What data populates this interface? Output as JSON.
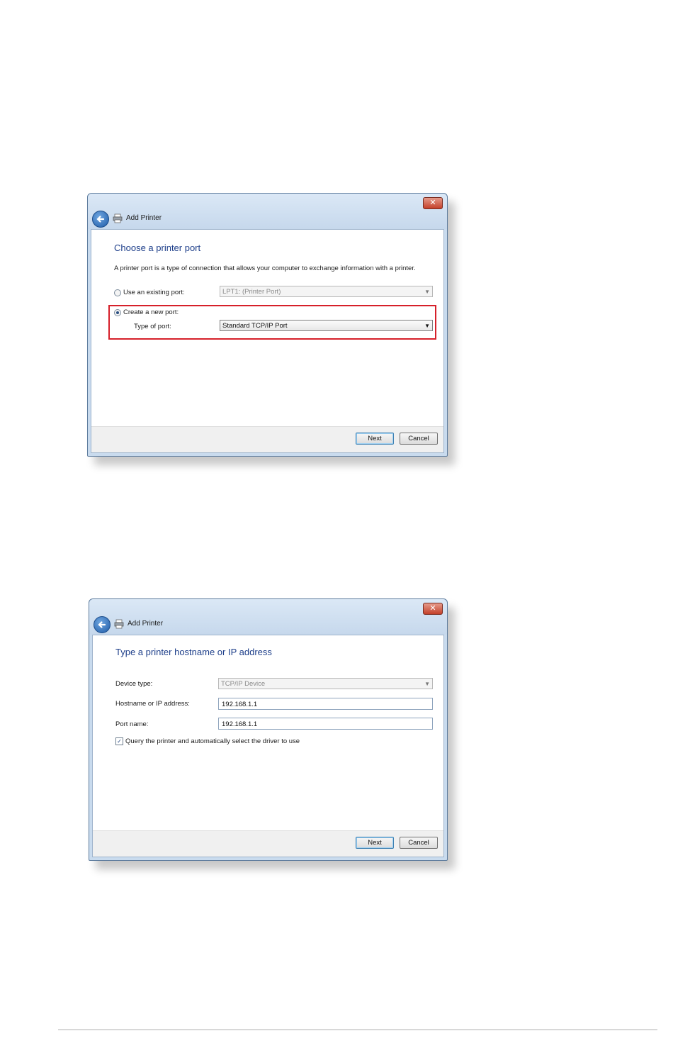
{
  "dialog1": {
    "title": "Add Printer",
    "close_glyph": "✕",
    "heading": "Choose a printer port",
    "description": "A printer port is a type of connection that allows your computer to exchange information with a printer.",
    "existing_port_label": "Use an existing port:",
    "existing_port_value": "LPT1: (Printer Port)",
    "existing_port_selected": false,
    "create_port_label": "Create a new port:",
    "create_port_selected": true,
    "type_of_port_label": "Type of port:",
    "type_of_port_value": "Standard TCP/IP Port",
    "next_label": "Next",
    "cancel_label": "Cancel",
    "highlight_color": "#d6202a"
  },
  "dialog2": {
    "title": "Add Printer",
    "close_glyph": "✕",
    "heading": "Type a printer hostname or IP address",
    "device_type_label": "Device type:",
    "device_type_value": "TCP/IP Device",
    "hostname_label": "Hostname or IP address:",
    "hostname_value": "192.168.1.1",
    "port_name_label": "Port name:",
    "port_name_value": "192.168.1.1",
    "query_label": "Query the printer and automatically select the driver to use",
    "query_checked": true,
    "next_label": "Next",
    "cancel_label": "Cancel"
  },
  "icons": {
    "back": "back-arrow-icon",
    "printer": "printer-icon",
    "close": "close-icon",
    "dropdown": "chevron-down-icon",
    "checkmark": "checkmark-icon"
  }
}
